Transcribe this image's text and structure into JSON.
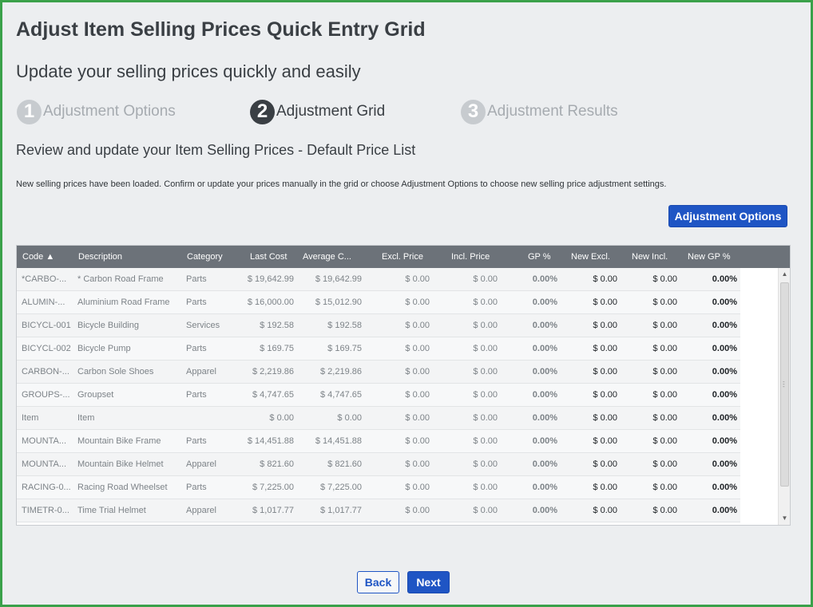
{
  "page": {
    "title": "Adjust Item Selling Prices Quick Entry Grid",
    "subtitle": "Update your selling prices quickly and easily"
  },
  "steps": [
    {
      "num": "1",
      "label": "Adjustment Options",
      "state": "inactive"
    },
    {
      "num": "2",
      "label": "Adjustment Grid",
      "state": "active"
    },
    {
      "num": "3",
      "label": "Adjustment Results",
      "state": "inactive"
    }
  ],
  "section": {
    "title": "Review and update your Item Selling Prices - Default Price List",
    "info": "New selling prices have been loaded. Confirm or update your prices manually in the grid or choose Adjustment Options to choose new selling price adjustment settings."
  },
  "buttons": {
    "adjustment_options": "Adjustment Options",
    "back": "Back",
    "next": "Next"
  },
  "grid": {
    "sort_column": "Code",
    "sort_direction": "ascending",
    "columns": [
      {
        "key": "code",
        "label": "Code ▲"
      },
      {
        "key": "description",
        "label": "Description"
      },
      {
        "key": "category",
        "label": "Category"
      },
      {
        "key": "last_cost",
        "label": "Last Cost"
      },
      {
        "key": "avg_cost",
        "label": "Average C..."
      },
      {
        "key": "excl_price",
        "label": "Excl. Price"
      },
      {
        "key": "incl_price",
        "label": "Incl. Price"
      },
      {
        "key": "gp",
        "label": "GP %"
      },
      {
        "key": "new_excl",
        "label": "New Excl."
      },
      {
        "key": "new_incl",
        "label": "New Incl."
      },
      {
        "key": "new_gp",
        "label": "New GP %"
      }
    ],
    "rows": [
      {
        "code": "*CARBO-...",
        "description": "* Carbon Road Frame",
        "category": "Parts",
        "last_cost": "$ 19,642.99",
        "avg_cost": "$ 19,642.99",
        "excl_price": "$ 0.00",
        "incl_price": "$ 0.00",
        "gp": "0.00%",
        "new_excl": "$ 0.00",
        "new_incl": "$ 0.00",
        "new_gp": "0.00%"
      },
      {
        "code": "ALUMIN-...",
        "description": "Aluminium Road Frame",
        "category": "Parts",
        "last_cost": "$ 16,000.00",
        "avg_cost": "$ 15,012.90",
        "excl_price": "$ 0.00",
        "incl_price": "$ 0.00",
        "gp": "0.00%",
        "new_excl": "$ 0.00",
        "new_incl": "$ 0.00",
        "new_gp": "0.00%"
      },
      {
        "code": "BICYCL-001",
        "description": "Bicycle Building",
        "category": "Services",
        "last_cost": "$ 192.58",
        "avg_cost": "$ 192.58",
        "excl_price": "$ 0.00",
        "incl_price": "$ 0.00",
        "gp": "0.00%",
        "new_excl": "$ 0.00",
        "new_incl": "$ 0.00",
        "new_gp": "0.00%"
      },
      {
        "code": "BICYCL-002",
        "description": "Bicycle Pump",
        "category": "Parts",
        "last_cost": "$ 169.75",
        "avg_cost": "$ 169.75",
        "excl_price": "$ 0.00",
        "incl_price": "$ 0.00",
        "gp": "0.00%",
        "new_excl": "$ 0.00",
        "new_incl": "$ 0.00",
        "new_gp": "0.00%"
      },
      {
        "code": "CARBON-...",
        "description": "Carbon Sole Shoes",
        "category": "Apparel",
        "last_cost": "$ 2,219.86",
        "avg_cost": "$ 2,219.86",
        "excl_price": "$ 0.00",
        "incl_price": "$ 0.00",
        "gp": "0.00%",
        "new_excl": "$ 0.00",
        "new_incl": "$ 0.00",
        "new_gp": "0.00%"
      },
      {
        "code": "GROUPS-...",
        "description": "Groupset",
        "category": "Parts",
        "last_cost": "$ 4,747.65",
        "avg_cost": "$ 4,747.65",
        "excl_price": "$ 0.00",
        "incl_price": "$ 0.00",
        "gp": "0.00%",
        "new_excl": "$ 0.00",
        "new_incl": "$ 0.00",
        "new_gp": "0.00%"
      },
      {
        "code": "Item",
        "description": "Item",
        "category": "",
        "last_cost": "$ 0.00",
        "avg_cost": "$ 0.00",
        "excl_price": "$ 0.00",
        "incl_price": "$ 0.00",
        "gp": "0.00%",
        "new_excl": "$ 0.00",
        "new_incl": "$ 0.00",
        "new_gp": "0.00%"
      },
      {
        "code": "MOUNTA...",
        "description": "Mountain Bike Frame",
        "category": "Parts",
        "last_cost": "$ 14,451.88",
        "avg_cost": "$ 14,451.88",
        "excl_price": "$ 0.00",
        "incl_price": "$ 0.00",
        "gp": "0.00%",
        "new_excl": "$ 0.00",
        "new_incl": "$ 0.00",
        "new_gp": "0.00%"
      },
      {
        "code": "MOUNTA...",
        "description": "Mountain Bike Helmet",
        "category": "Apparel",
        "last_cost": "$ 821.60",
        "avg_cost": "$ 821.60",
        "excl_price": "$ 0.00",
        "incl_price": "$ 0.00",
        "gp": "0.00%",
        "new_excl": "$ 0.00",
        "new_incl": "$ 0.00",
        "new_gp": "0.00%"
      },
      {
        "code": "RACING-0...",
        "description": "Racing Road Wheelset",
        "category": "Parts",
        "last_cost": "$ 7,225.00",
        "avg_cost": "$ 7,225.00",
        "excl_price": "$ 0.00",
        "incl_price": "$ 0.00",
        "gp": "0.00%",
        "new_excl": "$ 0.00",
        "new_incl": "$ 0.00",
        "new_gp": "0.00%"
      },
      {
        "code": "TIMETR-0...",
        "description": "Time Trial Helmet",
        "category": "Apparel",
        "last_cost": "$ 1,017.77",
        "avg_cost": "$ 1,017.77",
        "excl_price": "$ 0.00",
        "incl_price": "$ 0.00",
        "gp": "0.00%",
        "new_excl": "$ 0.00",
        "new_incl": "$ 0.00",
        "new_gp": "0.00%"
      }
    ]
  },
  "icons": {
    "scroll_up": "scroll-up-arrow-icon",
    "scroll_down": "scroll-down-arrow-icon",
    "sort_asc": "sort-ascending-icon"
  },
  "colors": {
    "frame_border": "#3aa14a",
    "background": "#eceef0",
    "primary": "#1f55c4",
    "header": "#6c7279",
    "step_active": "#3a3f44",
    "step_inactive": "#c7cbcf"
  }
}
